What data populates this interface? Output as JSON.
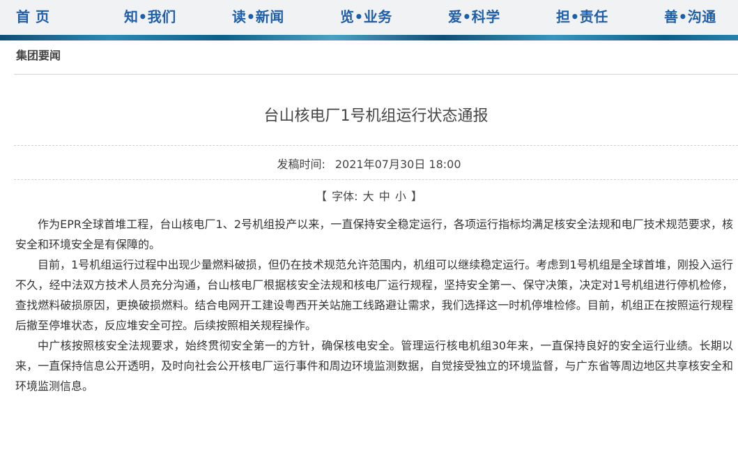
{
  "nav": {
    "items": [
      {
        "label": "首 页"
      },
      {
        "label": "知•我们"
      },
      {
        "label": "读•新闻"
      },
      {
        "label": "览•业务"
      },
      {
        "label": "爱•科学"
      },
      {
        "label": "担•责任"
      },
      {
        "label": "善•沟通"
      }
    ]
  },
  "section": {
    "title": "集团要闻"
  },
  "article": {
    "title": "台山核电厂1号机组运行状态通报",
    "published_label": "发稿时间:",
    "published_value": "2021年07月30日 18:00",
    "font_size": {
      "open": "【",
      "label": "字体:",
      "large": "大",
      "medium": "中",
      "small": "小",
      "close": "】"
    },
    "paragraphs": [
      "作为EPR全球首堆工程，台山核电厂1、2号机组投产以来，一直保持安全稳定运行，各项运行指标均满足核安全法规和电厂技术规范要求，核安全和环境安全是有保障的。",
      "目前，1号机组运行过程中出现少量燃料破损，但仍在技术规范允许范围内，机组可以继续稳定运行。考虑到1号机组是全球首堆，刚投入运行不久，经中法双方技术人员充分沟通，台山核电厂根据核安全法规和核电厂运行规程，坚持安全第一、保守决策，决定对1号机组进行停机检修，查找燃料破损原因，更换破损燃料。结合电网开工建设粤西开关站施工线路避让需求，我们选择这一时机停堆检修。目前，机组正在按照运行规程后撤至停堆状态，反应堆安全可控。后续按照相关规程操作。",
      "中广核按照核安全法规要求，始终贯彻安全第一的方针，确保核电安全。管理运行核电机组30年来，一直保持良好的安全运行业绩。长期以来，一直保持信息公开透明，及时向社会公开核电厂运行事件和周边环境监测数据，自觉接受独立的环境监督，与广东省等周边地区共享核安全和环境监测信息。"
    ]
  },
  "colors": {
    "nav_text": "#1f5fa8",
    "nav_bg": "#f1f2f4",
    "body_text": "#333333"
  }
}
